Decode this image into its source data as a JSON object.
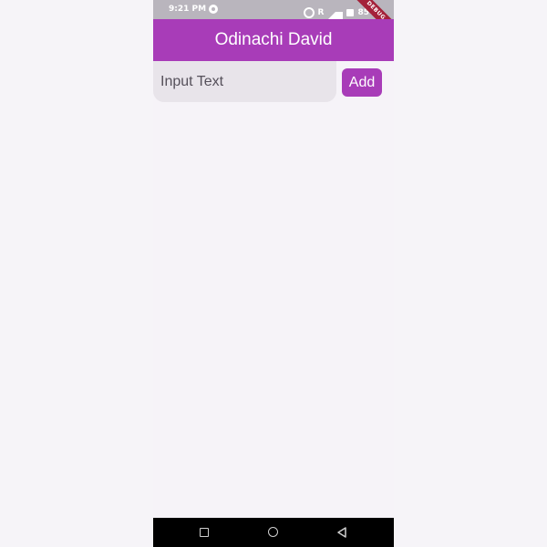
{
  "status_bar": {
    "time": "9:21 PM",
    "battery": "85%",
    "signal_text": "R",
    "debug_ribbon": "DEBUG",
    "icons": [
      "app-notification-icon",
      "hotspot-icon",
      "signal-icon",
      "battery-icon"
    ]
  },
  "app_bar": {
    "title": "Odinachi David"
  },
  "input": {
    "placeholder": "Input Text",
    "value": ""
  },
  "add_button": {
    "label": "Add"
  },
  "navigation_bar": {
    "icons": [
      "recents-icon",
      "home-icon",
      "back-icon"
    ]
  },
  "colors": {
    "accent": "#a83cb8",
    "background": "#f6f3f8",
    "input_fill": "#e8e4ea",
    "nav_bar": "#000000",
    "status_bar": "#b9b5bd",
    "debug_ribbon": "#a4223a"
  }
}
